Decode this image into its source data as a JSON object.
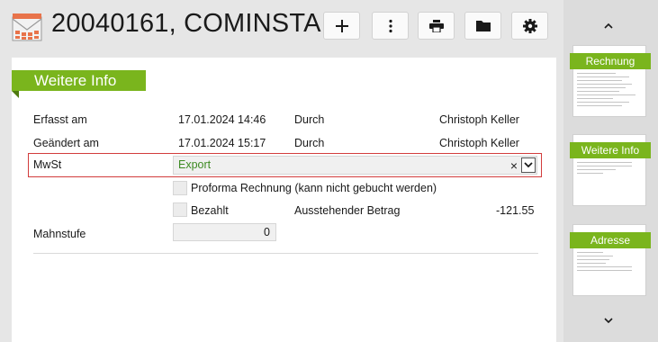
{
  "header": {
    "title": "20040161, COMINSTA...",
    "app_icon": "calendar-mail-icon",
    "buttons": [
      {
        "name": "add-button",
        "icon": "plus-icon"
      },
      {
        "name": "more-button",
        "icon": "more-vertical-icon"
      },
      {
        "name": "print-button",
        "icon": "printer-icon"
      },
      {
        "name": "folder-button",
        "icon": "folder-icon"
      },
      {
        "name": "settings-button",
        "icon": "gear-icon"
      }
    ]
  },
  "section": {
    "title": "Weitere Info"
  },
  "fields": {
    "erfasst": {
      "label": "Erfasst am",
      "date": "17.01.2024 14:46",
      "by_label": "Durch",
      "by": "Christoph Keller"
    },
    "geaendert": {
      "label": "Geändert am",
      "date": "17.01.2024 15:17",
      "by_label": "Durch",
      "by": "Christoph Keller"
    },
    "mwst": {
      "label": "MwSt",
      "value": "Export",
      "clear": "×"
    },
    "proforma": {
      "label": "Proforma Rechnung (kann nicht gebucht werden)",
      "checked": false
    },
    "bezahlt": {
      "label": "Bezahlt",
      "checked": false,
      "outstanding_label": "Ausstehender Betrag",
      "outstanding_value": "-121.55"
    },
    "mahnstufe": {
      "label": "Mahnstufe",
      "value": "0"
    }
  },
  "sidebar": {
    "thumbnails": [
      {
        "label": "Rechnung"
      },
      {
        "label": "Weitere Info"
      },
      {
        "label": "Adresse"
      }
    ]
  },
  "colors": {
    "accent": "#7ab51d",
    "mwst_value": "#3d8a22",
    "highlight_border": "#d23c3c"
  }
}
